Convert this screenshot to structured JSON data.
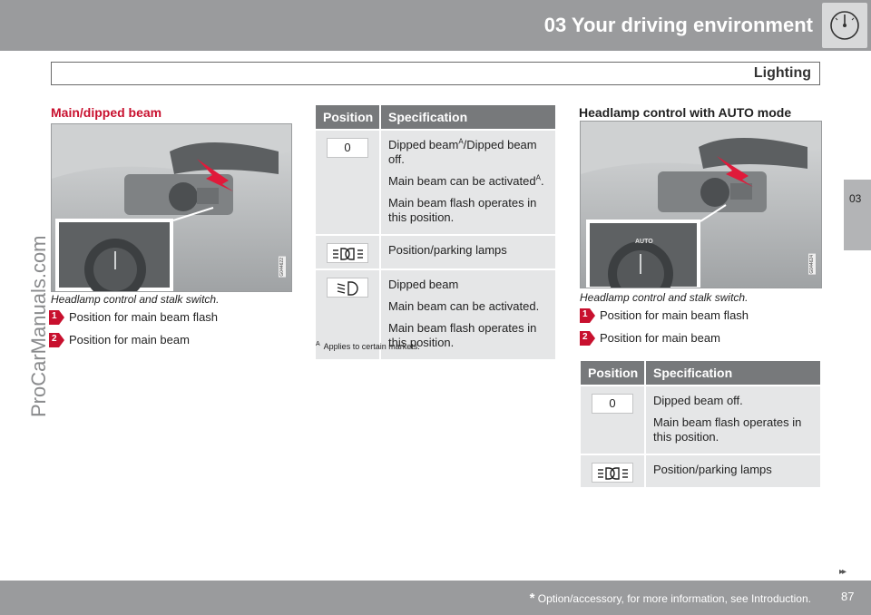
{
  "header": {
    "chapter_title": "03 Your driving environment",
    "section": "Lighting",
    "side_tab": "03",
    "gauge_icon": "gauge-icon"
  },
  "watermark": "ProCarManuals.com",
  "left_column": {
    "heading": "Main/dipped beam",
    "image_code": "G044622",
    "caption": "Headlamp control and stalk switch.",
    "legend": [
      {
        "number": "1",
        "text": "Position for main beam flash"
      },
      {
        "number": "2",
        "text": "Position for main beam"
      }
    ]
  },
  "table1": {
    "headers": [
      "Position",
      "Specification"
    ],
    "rows": [
      {
        "position_label": "0",
        "lines": [
          "Dipped beam",
          "/Dipped beam off.",
          "Main beam can be activated",
          ".",
          "Main beam flash operates in this position."
        ]
      },
      {
        "position_icon": "parking-lamps-icon",
        "lines": [
          "Position/parking lamps"
        ]
      },
      {
        "position_icon": "dipped-beam-icon",
        "lines": [
          "Dipped beam",
          "Main beam can be activated.",
          "Main beam flash operates in this position."
        ]
      }
    ],
    "sup_mark": "A",
    "footnote_mark": "A",
    "footnote_text": "Applies to certain markets."
  },
  "right_column": {
    "heading": "Headlamp control with AUTO mode",
    "image_code": "G044624",
    "inset_label": "AUTO",
    "caption": "Headlamp control and stalk switch.",
    "legend": [
      {
        "number": "1",
        "text": "Position for main beam flash"
      },
      {
        "number": "2",
        "text": "Position for main beam"
      }
    ]
  },
  "table2": {
    "headers": [
      "Position",
      "Specification"
    ],
    "rows": [
      {
        "position_label": "0",
        "lines": [
          "Dipped beam off.",
          "Main beam flash operates in this position."
        ]
      },
      {
        "position_icon": "parking-lamps-icon",
        "lines": [
          "Position/parking lamps"
        ]
      }
    ]
  },
  "footer": {
    "asterisk": "*",
    "note": " Option/accessory, for more information, see Introduction.",
    "page_number": "87",
    "continue_arrows": "▸▸"
  },
  "colors": {
    "bar_gray": "#9a9b9d",
    "heading_red": "#c8102e",
    "table_header": "#77797b",
    "table_cell": "#e5e6e7"
  }
}
